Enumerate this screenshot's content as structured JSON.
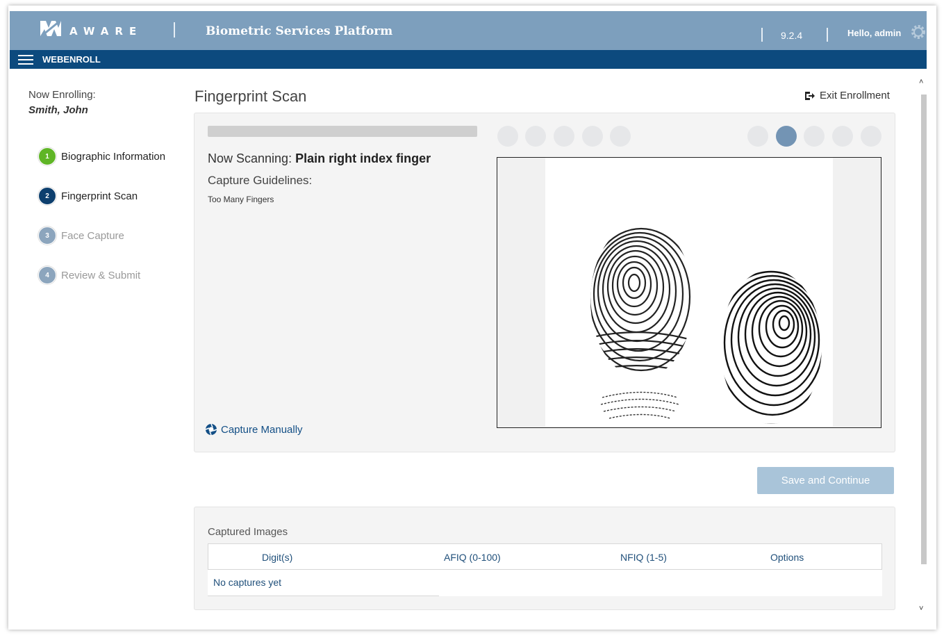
{
  "header": {
    "brand": "AWARE",
    "platform": "Biometric Services Platform",
    "version": "9.2.4",
    "greeting": "Hello, admin"
  },
  "nav": {
    "title": "WEBENROLL"
  },
  "enrollee": {
    "label": "Now Enrolling:",
    "name": "Smith, John"
  },
  "steps": [
    {
      "num": "1",
      "label": "Biographic Information",
      "status": "complete"
    },
    {
      "num": "2",
      "label": "Fingerprint Scan",
      "status": "current"
    },
    {
      "num": "3",
      "label": "Face Capture",
      "status": "pending"
    },
    {
      "num": "4",
      "label": "Review & Submit",
      "status": "pending"
    }
  ],
  "main": {
    "title": "Fingerprint Scan",
    "exit_label": "Exit Enrollment",
    "scan_prefix": "Now Scanning:",
    "scan_finger": "Plain right index finger",
    "guidelines_label": "Capture Guidelines:",
    "guideline": "Too Many Fingers",
    "capture_manually": "Capture Manually",
    "save_button": "Save and Continue",
    "finger_indicators": {
      "left_hand_count": 5,
      "right_hand_count": 5,
      "active_right_index": 2
    }
  },
  "captured": {
    "title": "Captured Images",
    "columns": [
      "Digit(s)",
      "AFIQ (0-100)",
      "NFIQ (1-5)",
      "Options"
    ],
    "empty_message": "No captures yet"
  },
  "colors": {
    "topbar": "#7d9fbd",
    "navbar": "#0c4a7e",
    "step_complete": "#5fb526",
    "step_current": "#0d3f6e",
    "step_pending": "#8ca5bd",
    "link": "#134f86",
    "button_disabled": "#a9c4d9"
  }
}
